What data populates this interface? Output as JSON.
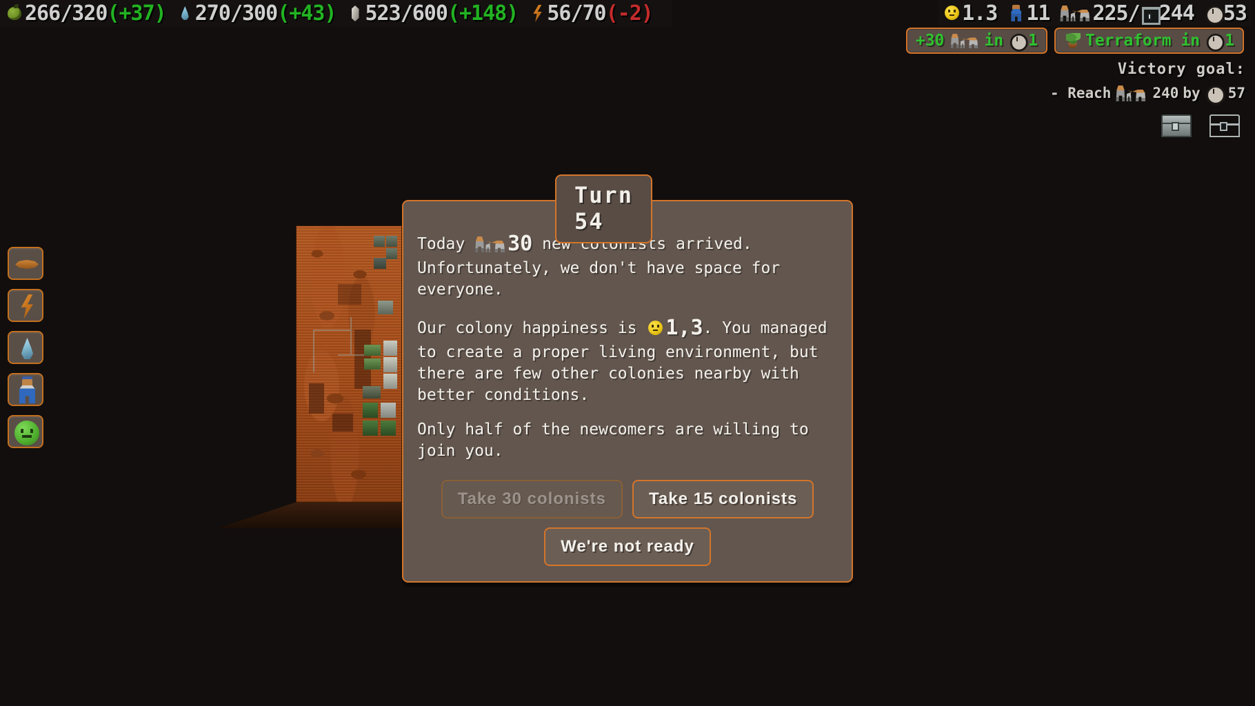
{
  "colors": {
    "accent": "#d4752a",
    "panel": "#62564e",
    "panel_light": "#6b5e55",
    "gain": "#22b322",
    "loss": "#c42b2b",
    "text": "#f4f1ec",
    "badge_text": "#2fc12f",
    "terrain": "#b55a22"
  },
  "topbar": {
    "resources": [
      {
        "icon": "food-icon",
        "current": "266",
        "sep": "/",
        "max": "320",
        "delta": "(+37)",
        "delta_sign": "gain"
      },
      {
        "icon": "water-icon",
        "current": "270",
        "sep": "/",
        "max": "300",
        "delta": "(+43)",
        "delta_sign": "gain"
      },
      {
        "icon": "metal-icon",
        "current": "523",
        "sep": "/",
        "max": "600",
        "delta": "(+148)",
        "delta_sign": "gain"
      },
      {
        "icon": "energy-icon",
        "current": "56",
        "sep": "/",
        "max": "70",
        "delta": "(-2)",
        "delta_sign": "loss"
      }
    ]
  },
  "topright": {
    "stats": [
      {
        "icon": "happiness-icon",
        "value": "1.3"
      },
      {
        "icon": "worker-icon",
        "value": "11"
      },
      {
        "icon": "population-icon",
        "value": "225"
      },
      {
        "icon": "separator",
        "value": "/"
      },
      {
        "icon": "housing-icon",
        "value": "244"
      },
      {
        "icon": "clock-icon",
        "value": "53"
      }
    ]
  },
  "badges": [
    {
      "name": "population-growth-badge",
      "prefix": "+30",
      "icon": "population-icon",
      "middle": "in",
      "clock_icon": "clock-icon",
      "turns": "1"
    },
    {
      "name": "terraform-badge",
      "prefix": "",
      "icon": "plant-icon",
      "middle": "Terraform in",
      "clock_icon": "clock-icon",
      "turns": "1"
    }
  ],
  "victory": {
    "title": "Victory goal:",
    "goal_prefix": "- Reach",
    "goal_icon": "population-icon",
    "goal_amount": "240",
    "goal_by": "by",
    "goal_clock_icon": "clock-icon",
    "goal_turn": "57"
  },
  "storage_icons": [
    {
      "name": "storage-full-icon",
      "label": "chest-filled"
    },
    {
      "name": "storage-empty-icon",
      "label": "chest-empty"
    }
  ],
  "left_toolbar": [
    {
      "name": "sidebar-item-ore",
      "icon": "ore-icon"
    },
    {
      "name": "sidebar-item-energy",
      "icon": "energy-icon"
    },
    {
      "name": "sidebar-item-water",
      "icon": "water-icon"
    },
    {
      "name": "sidebar-item-workers",
      "icon": "worker-icon"
    },
    {
      "name": "sidebar-item-happiness",
      "icon": "happiness-icon"
    }
  ],
  "dialog": {
    "title": "Turn 54",
    "paragraph1_a": "Today",
    "paragraph1_count": "30",
    "paragraph1_b": "new colonists arrived. Unfortunately, we don't have space for everyone.",
    "paragraph2_a": "Our colony happiness is",
    "paragraph2_value": "1,3",
    "paragraph2_b": ". You managed to create a proper living environment, but there are few other colonies nearby with better conditions.",
    "paragraph3": "Only half of the newcomers are willing to join you.",
    "buttons": [
      {
        "name": "take-30-colonists-button",
        "label": "Take 30 colonists",
        "disabled": true
      },
      {
        "name": "take-15-colonists-button",
        "label": "Take 15 colonists",
        "disabled": false
      },
      {
        "name": "not-ready-button",
        "label": "We're not ready",
        "disabled": false
      }
    ]
  }
}
